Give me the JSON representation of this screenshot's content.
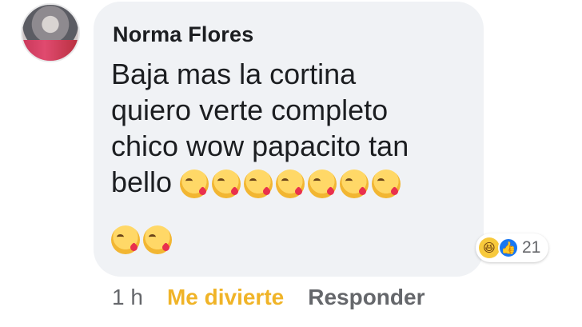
{
  "comment": {
    "author": "Norma Flores",
    "text_lines": [
      "Baja mas la cortina",
      "quiero verte completo",
      "chico wow papacito tan",
      "bello"
    ],
    "emoji_name": "face-blowing-kiss",
    "emoji_count_line1": 7,
    "emoji_count_line2": 2,
    "reactions": {
      "icons": [
        "haha-icon",
        "like-icon"
      ],
      "count": "21"
    }
  },
  "meta": {
    "time": "1 h",
    "reaction_label": "Me divierte",
    "reply_label": "Responder"
  },
  "colors": {
    "bubble": "#f0f2f5",
    "reaction_active": "#f0b428",
    "secondary_text": "#65676b",
    "like_blue": "#1877f2"
  }
}
